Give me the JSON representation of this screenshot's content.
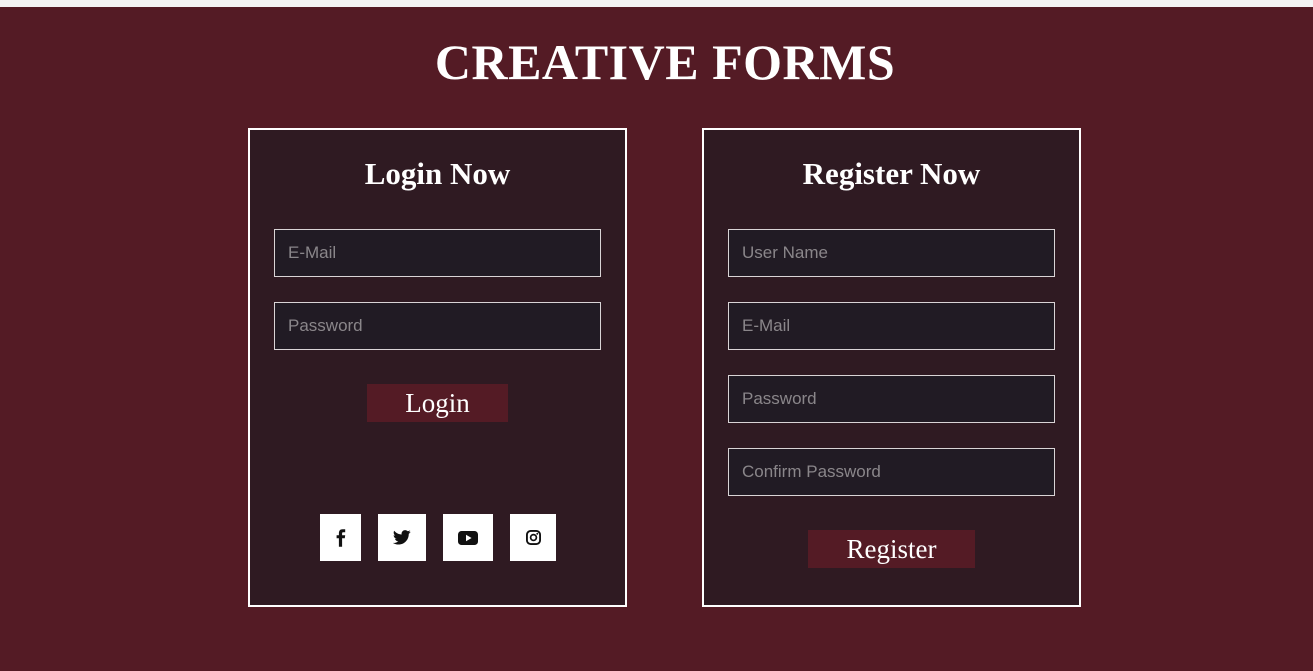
{
  "page": {
    "title": "CREATIVE FORMS"
  },
  "login": {
    "title": "Login Now",
    "email_placeholder": "E-Mail",
    "password_placeholder": "Password",
    "button_label": "Login",
    "socials": [
      "facebook-icon",
      "twitter-icon",
      "youtube-icon",
      "instagram-icon"
    ]
  },
  "register": {
    "title": "Register Now",
    "username_placeholder": "User Name",
    "email_placeholder": "E-Mail",
    "password_placeholder": "Password",
    "confirm_placeholder": "Confirm Password",
    "button_label": "Register"
  },
  "colors": {
    "background": "#541b25",
    "card": "#2f1a22",
    "input": "#211b24",
    "button": "#541b25",
    "text": "#ffffff"
  }
}
